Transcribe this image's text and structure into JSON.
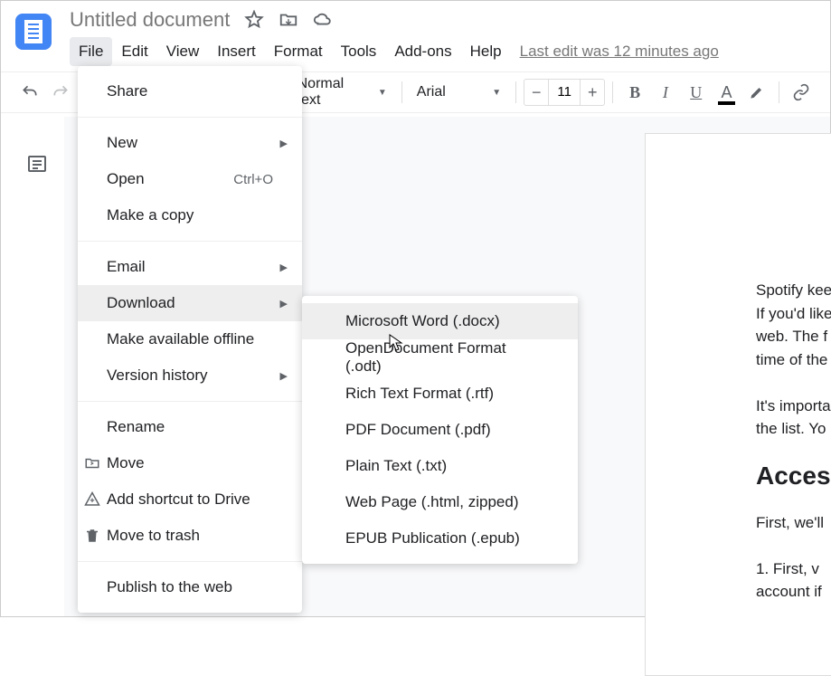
{
  "doc_title": "Untitled document",
  "menubar": [
    "File",
    "Edit",
    "View",
    "Insert",
    "Format",
    "Tools",
    "Add-ons",
    "Help"
  ],
  "last_edit": "Last edit was 12 minutes ago",
  "toolbar": {
    "style": "Normal text",
    "font": "Arial",
    "font_size": "11"
  },
  "file_menu": {
    "share": "Share",
    "new": "New",
    "open": "Open",
    "open_shortcut": "Ctrl+O",
    "make_copy": "Make a copy",
    "email": "Email",
    "download": "Download",
    "offline": "Make available offline",
    "version": "Version history",
    "rename": "Rename",
    "move": "Move",
    "shortcut": "Add shortcut to Drive",
    "trash": "Move to trash",
    "publish": "Publish to the web"
  },
  "download_menu": [
    "Microsoft Word (.docx)",
    "OpenDocument Format (.odt)",
    "Rich Text Format (.rtf)",
    "PDF Document (.pdf)",
    "Plain Text (.txt)",
    "Web Page (.html, zipped)",
    "EPUB Publication (.epub)"
  ],
  "doc_body": {
    "p1": "Spotify kee",
    "p2": "If you'd like",
    "p3": "web. The f",
    "p4": "time of the",
    "p5": "It's importa",
    "p6": "the list. Yo",
    "h": "Access",
    "p7": "First, we'll",
    "p8": "1.    First, v",
    "p9": "account if"
  }
}
